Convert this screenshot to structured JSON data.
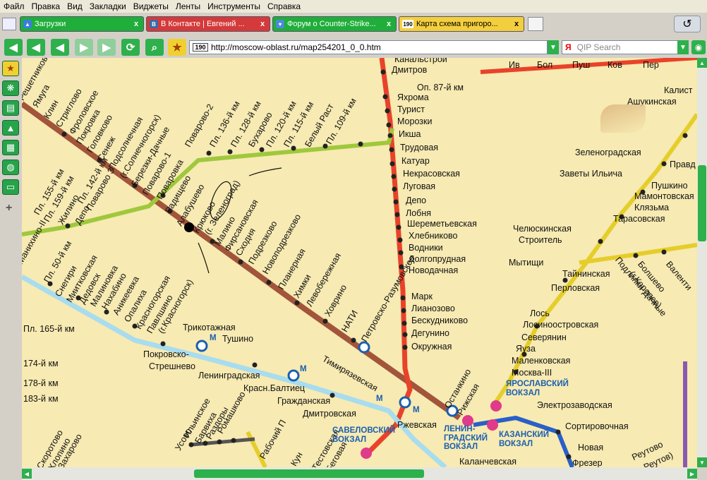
{
  "menu": [
    "Файл",
    "Правка",
    "Вид",
    "Закладки",
    "Виджеты",
    "Ленты",
    "Инструменты",
    "Справка"
  ],
  "tabs": [
    {
      "label": "Загрузки",
      "color": "#1fae3a",
      "icon": "downloads-icon",
      "glyph": "▲"
    },
    {
      "label": "В Контакте | Евгений ...",
      "color": "#d43a3a",
      "icon": "vk-icon",
      "glyph": "B"
    },
    {
      "label": "Форум о Counter-Strike...",
      "color": "#1fae3a",
      "icon": "forum-icon",
      "glyph": "♥"
    },
    {
      "label": "Карта схема пригоро...",
      "color": "#f4cf3d",
      "icon": "site-190-icon",
      "glyph": "190"
    }
  ],
  "tab_close": "x",
  "address": {
    "url": "http://moscow-oblast.ru/map254201_0_0.htm",
    "site_badge": "190"
  },
  "search": {
    "engine_glyph": "Я",
    "placeholder": "QIP Search"
  },
  "sidebar_icons": [
    "favorites-icon",
    "widgets-icon",
    "notes-icon",
    "downloads-icon",
    "calendar-icon",
    "globe-icon",
    "tv-icon"
  ],
  "sidebar_add": "+",
  "colors": {
    "map_bg": "#f7eab2",
    "savelovsky_line": "#e8432a",
    "leningrad_line": "#a2553a",
    "riga_line": "#9fc83c",
    "belarus_line": "#a8dcef",
    "yaroslavl_line": "#e5cd2a",
    "kazan_line": "#2a5fc8",
    "chrome_green": "#27a34a"
  },
  "map": {
    "stations": {
      "kanalstroy": "Канальстрой",
      "dmitrov": "Дмитров",
      "op87": "Оп. 87-й км",
      "yakhroma": "Яхрома",
      "turist": "Турист",
      "morozki": "Морозки",
      "iksha": "Икша",
      "trudovaya": "Трудовая",
      "katuar": "Катуар",
      "nekrasovskaya": "Некрасовская",
      "lugovaya": "Луговая",
      "depo": "Депо",
      "lobnya": "Лобня",
      "sheremetyevskaya": "Шереметьевская",
      "khlebnikovo": "Хлебниково",
      "vodniki": "Водники",
      "dolgoprudnaya": "Долгопрудная",
      "novodachnaya": "Новодачная",
      "mark": "Марк",
      "lianozovo": "Лианозово",
      "beskudnikovo": "Бескудниково",
      "degunino": "Дегунино",
      "okruzhnaya": "Окружная",
      "reshetnikovo": "Решетниково",
      "yamuga": "Ямуга",
      "klin": "Клин",
      "striglovo": "Стриглово",
      "frolovskoe": "Фроловское",
      "pokrovka": "Покровка",
      "golovkovo": "Головково",
      "senezh": "Сенеж",
      "podsolnechnaya": "Подсолнечная",
      "solnechnogorsk": "(г.Солнечногорск)",
      "berezki": "Березки-Дачные",
      "povarovo1": "Поварово-1",
      "povarovo2": "Поварово-2",
      "povarovo3": "Поварово 3",
      "p136": "Пл. 136-й км",
      "p128": "Пл. 128-й км",
      "bukharovo": "Бухарово",
      "p120": "Пл. 120-й км",
      "p115": "Пл. 115-й км",
      "bely_rast": "Белый Раст",
      "p109": "Пл. 109-й км",
      "p142": "Пл. 142-й км",
      "p155": "Пл. 155-й км",
      "p159": "Пл. 159-й км",
      "povarovka": "Поваровка",
      "depo2": "Депо",
      "zhilino": "Жилино",
      "radischevo": "Радищево",
      "alabushevo": "Алабушево",
      "kryukovo": "Крюково",
      "zelenograd": "(г. Зеленоград)",
      "malino": "Малино",
      "firsanovskaya": "Фирсановская",
      "skhodnya": "Сходня",
      "podrezkovo": "Подрезково",
      "novopodrezkovo": "Новоподрезково",
      "planernaya": "Планерная",
      "khimki": "Химки",
      "levoberezhnaya": "Левобережная",
      "khovrino": "Ховрино",
      "nati": "НАТИ",
      "petrovsko": "Петровско-Разумовское",
      "manikhino": "Манихино-II",
      "p50": "Пл. 50-й км",
      "snegiri": "Снегири",
      "mitkovskaya": "Миитковская",
      "dedovsk": "Дедовск",
      "malinovka": "Малиновка",
      "nakhabino": "Нахабино",
      "anikeevka": "Аникеевка",
      "opalikha": "Опалиха",
      "krasnogorskaya": "Красногорская",
      "pavlshino": "Павлшино",
      "krasnogorsk": "(г.Красногорск)",
      "p165": "Пл. 165-й км",
      "trikotazhnaya": "Трикотажная",
      "tushino": "Тушино",
      "pokrovsko": "Покровско-",
      "streshnevo": "Стрешнево",
      "leningradskaya": "Ленинградская",
      "krasn_baltiets": "Красн.Балтиец",
      "grazhdanskaya": "Гражданская",
      "timiryazevskaya": "Тимирязевская",
      "dmitrovskaya": "Дмитровская",
      "rzhevskaya": "Ржевская",
      "ostankino": "Останкино",
      "rizhskaya": "Рижская",
      "kalanchevskaya": "Каланчевская",
      "p174": "174-й км",
      "p178": "178-й км",
      "p183": "183-й км",
      "usovo": "Усово",
      "ilinskoe": "Ильинское",
      "barvikha": "Барвиха",
      "razdory": "Раздоры",
      "romashkovo": "Ромашково",
      "rabochiy": "Рабочий П",
      "testovskaya": "Тестовская",
      "begovaya": "Беговая",
      "kuntsevo": "Кун",
      "skorotovo": "Скоротово",
      "zakharovo": "Захарово",
      "khlopino": "Хлопино",
      "savelovsky": "САВЕЛОВСКИЙ ВОКЗАЛ",
      "leningradsky": "ЛЕНИН-ГРАДСКИЙ ВОКЗАЛ",
      "yaroslavsky": "ЯРОСЛАВСКИЙ ВОКЗАЛ",
      "kazansky": "КАЗАНСКИЙ ВОКЗАЛ",
      "metro_m": "М",
      "kalist": "Калист",
      "ashukinskaya": "Ашукинская",
      "zelenogradskaya": "Зеленоградская",
      "zavety": "Заветы Ильича",
      "pravda": "Правд",
      "pushkino": "Пушкино",
      "mamontovskaya": "Мамонтовская",
      "klyazma": "Клязьма",
      "tarasovskaya": "Тарасовская",
      "chelyuskinskaya": "Челюскинская",
      "stroitel": "Строитель",
      "mytishchi": "Мытищи",
      "tayninskaya": "Тайнинская",
      "perlovskaya": "Перловская",
      "podlipki": "Подлипки-Дачные",
      "korolev": "(г.Королев)",
      "bolshevo": "Болшево",
      "valentinovka": "Валенти",
      "losa": "Лось",
      "losinoostrovskaya": "Лосиноостровская",
      "severyanin": "Северянин",
      "yauza": "Яуза",
      "malenkovskaya": "Маленковская",
      "moskva3": "Москва-III",
      "elektrozavodskaya": "Электрозаводская",
      "sortirovochnaya": "Сортировочная",
      "reutovo": "Реутово",
      "reutov": "(г. Реутов)",
      "novaya": "Новая",
      "frezer": "Фрезер",
      "top_a": "Ив",
      "top_b": "Бол",
      "top_c": "Пуш",
      "top_d": "Ков",
      "top_e": "Пер"
    }
  }
}
